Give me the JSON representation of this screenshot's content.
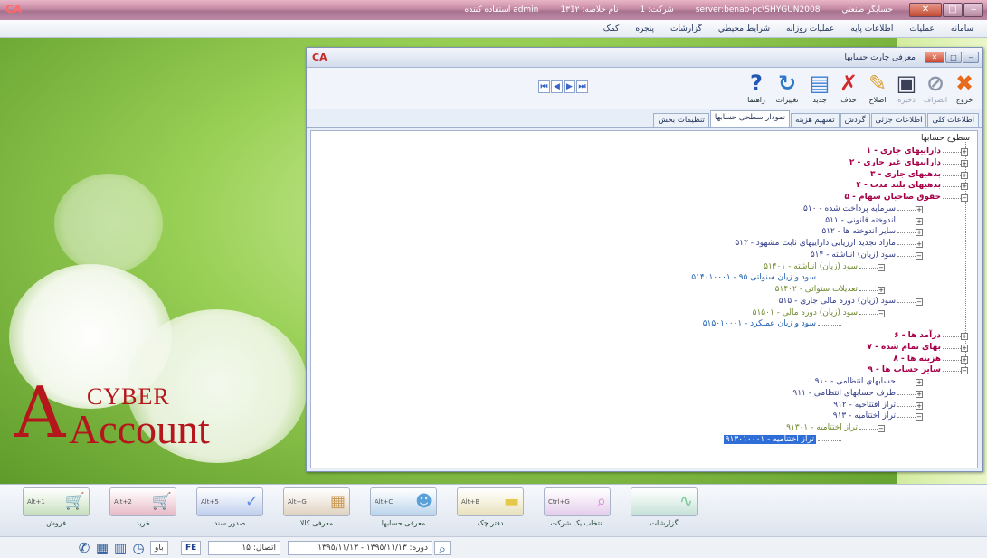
{
  "titlebar": {
    "logo": "CA",
    "app_name": "حسابگر صنعتي",
    "server": "server:benab-pc\\SHYGUN2008",
    "company": "شرکت: 1",
    "book": "نام خلاصه: 1٣1٢",
    "user": "admin استفاده كننده",
    "btn_min": "‒",
    "btn_max": "□",
    "btn_close": "✕"
  },
  "menu": [
    "سامانه",
    "عمليات",
    "اطلاعات پايه",
    "عمليات روزانه",
    "شرايط محيطي",
    "گزارشات",
    "پنجره",
    "کمک"
  ],
  "logo": {
    "mark": "A",
    "cyber": "CYBER",
    "account": "Account"
  },
  "dialog": {
    "title": "معرفی چارت حسابها",
    "icon": "CA",
    "toolbar": {
      "exit": "خروج",
      "cancel": "انصراف",
      "save": "ذخيره",
      "edit": "اصلاح",
      "delete": "حذف",
      "new": "جدید",
      "changes": "تغییرات",
      "help": "راهنما"
    },
    "nav": [
      "⏮",
      "◀",
      "▶",
      "⏭"
    ],
    "tabs": [
      "اطلاعات کلی",
      "اطلاعات جزئی",
      "گردش",
      "تسهیم هزینه",
      "نمودار سطحی حسابها",
      "تنظیمات بخش"
    ],
    "active_tab": 4,
    "tree": {
      "root": "سطوح حسابها",
      "nodes": [
        {
          "label": "داراییهای جاری - ۱",
          "level": 1,
          "expander": "+"
        },
        {
          "label": "داراییهای غیر جاری - ۲",
          "level": 1,
          "expander": "+"
        },
        {
          "label": "بدهیهای جاری - ۳",
          "level": 1,
          "expander": "+"
        },
        {
          "label": "بدهیهای بلند مدت - ۴",
          "level": 1,
          "expander": "+"
        },
        {
          "label": "حقوق صاحبان سهام - ۵",
          "level": 1,
          "expander": "−"
        },
        {
          "label": "سرمایه پرداخت شده - ۵۱۰",
          "level": 2,
          "expander": "+"
        },
        {
          "label": "اندوخته قانونی - ۵۱۱",
          "level": 2,
          "expander": "+"
        },
        {
          "label": "سایر اندوخته ها - ۵۱۲",
          "level": 2,
          "expander": "+"
        },
        {
          "label": "مازاد تجدید ارزیابی داراییهای ثابت مشهود - ۵۱۳",
          "level": 2,
          "expander": "+"
        },
        {
          "label": "سود (زیان) انباشته - ۵۱۴",
          "level": 2,
          "expander": "−"
        },
        {
          "label": "سود (زیان) انباشته - ۵۱۴۰۱",
          "level": 3,
          "expander": "−"
        },
        {
          "label": "سود و زیان سنواتی ۹۵ - ۵۱۴۰۱۰۰۰۱",
          "level": 4,
          "expander": ""
        },
        {
          "label": "تعدیلات سنواتی - ۵۱۴۰۲",
          "level": 3,
          "expander": "+"
        },
        {
          "label": "سود (زیان) دوره مالی جاری - ۵۱۵",
          "level": 2,
          "expander": "−"
        },
        {
          "label": "سود (زیان) دوره مالی - ۵۱۵۰۱",
          "level": 3,
          "expander": "−"
        },
        {
          "label": "سود و زیان عملکرد - ۵۱۵۰۱۰۰۰۱",
          "level": 4,
          "expander": ""
        },
        {
          "label": "درآمد ها - ۶",
          "level": 1,
          "expander": "+"
        },
        {
          "label": "بهای تمام شده - ۷",
          "level": 1,
          "expander": "+"
        },
        {
          "label": "هزینه ها - ۸",
          "level": 1,
          "expander": "+"
        },
        {
          "label": "سایر حساب ها - ۹",
          "level": 1,
          "expander": "−"
        },
        {
          "label": "حسابهای انتظامی - ۹۱۰",
          "level": 2,
          "expander": "+"
        },
        {
          "label": "طرف حسابهای انتظامی - ۹۱۱",
          "level": 2,
          "expander": "+"
        },
        {
          "label": "تراز افتتاحیه - ۹۱۲",
          "level": 2,
          "expander": "+"
        },
        {
          "label": "تراز اختتامیه - ۹۱۳",
          "level": 2,
          "expander": "−"
        },
        {
          "label": "تراز اختتامیه - ۹۱۳۰۱",
          "level": 3,
          "expander": "−"
        },
        {
          "label": "تراز اختتامیه - ۹۱۳۰۱۰۰۰۱",
          "level": 4,
          "expander": "",
          "selected": true
        }
      ]
    }
  },
  "shortcuts": [
    {
      "label": "فروش",
      "key": "Alt+1",
      "color": "#7fbf4d",
      "icon": "cart-icon"
    },
    {
      "label": "خرید",
      "key": "Alt+2",
      "color": "#e0506a",
      "icon": "cart-icon"
    },
    {
      "label": "صدور سند",
      "key": "Alt+5",
      "color": "#6a8fe0",
      "icon": "document-icon"
    },
    {
      "label": "معرفی کالا",
      "key": "Alt+G",
      "color": "#c99a55",
      "icon": "boxes-icon"
    },
    {
      "label": "معرفی حسابها",
      "key": "Alt+C",
      "color": "#5aa0d8",
      "icon": "people-icon"
    },
    {
      "label": "دفتر چک",
      "key": "Alt+B",
      "color": "#e5c84a",
      "icon": "cheque-icon"
    },
    {
      "label": "انتخاب یک شرکت",
      "key": "Ctrl+G",
      "color": "#d88ad8",
      "icon": "search-icon"
    },
    {
      "label": "گزارشات",
      "key": "",
      "color": "#7cc79a",
      "icon": "chart-icon"
    }
  ],
  "status": {
    "period": "دوره: ١٣٩٥/١١/١٣ - ١٣٩٥/١١/١٣",
    "connection": "اتصال: ١۵",
    "lang": "FE",
    "abbr": "باو"
  }
}
